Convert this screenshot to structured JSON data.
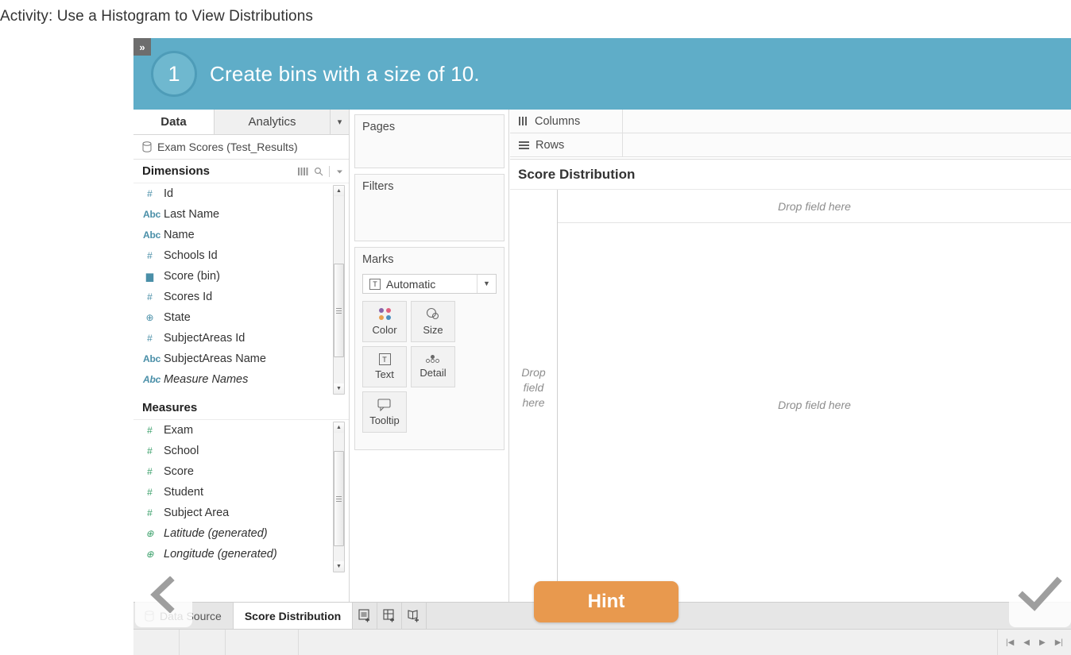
{
  "activity": {
    "title": "Activity: Use a Histogram to View Distributions"
  },
  "banner": {
    "collapse_label": "»",
    "step_number": "1",
    "instruction": "Create bins with a size of 10.",
    "background_color": "#5fadc8",
    "circle_color": "#6fb8cf"
  },
  "data_pane": {
    "tabs": [
      {
        "label": "Data",
        "active": true
      },
      {
        "label": "Analytics",
        "active": false
      }
    ],
    "tab_menu_icon": "vertical-ellipsis-icon",
    "datasource": {
      "icon": "database-icon",
      "label": "Exam Scores (Test_Results)"
    },
    "dimensions": {
      "title": "Dimensions",
      "icons": [
        "grid-icon",
        "search-icon",
        "chevron-down-icon"
      ],
      "fields": [
        {
          "icon": "number-icon",
          "glyph": "#",
          "label": "Id",
          "generated": false
        },
        {
          "icon": "text-abc-icon",
          "glyph": "Abc",
          "label": "Last Name",
          "generated": false
        },
        {
          "icon": "text-abc-icon",
          "glyph": "Abc",
          "label": "Name",
          "generated": false
        },
        {
          "icon": "number-icon",
          "glyph": "#",
          "label": "Schools Id",
          "generated": false
        },
        {
          "icon": "histogram-bin-icon",
          "glyph": "▆",
          "label": "Score (bin)",
          "generated": false
        },
        {
          "icon": "number-icon",
          "glyph": "#",
          "label": "Scores Id",
          "generated": false
        },
        {
          "icon": "geo-globe-icon",
          "glyph": "⊕",
          "label": "State",
          "generated": false
        },
        {
          "icon": "number-icon",
          "glyph": "#",
          "label": "SubjectAreas Id",
          "generated": false
        },
        {
          "icon": "text-abc-icon",
          "glyph": "Abc",
          "label": "SubjectAreas Name",
          "generated": false
        },
        {
          "icon": "text-abc-icon",
          "glyph": "Abc",
          "label": "Measure Names",
          "generated": true
        }
      ]
    },
    "measures": {
      "title": "Measures",
      "fields": [
        {
          "icon": "number-icon",
          "glyph": "#",
          "label": "Exam",
          "generated": false
        },
        {
          "icon": "number-icon",
          "glyph": "#",
          "label": "School",
          "generated": false
        },
        {
          "icon": "number-icon",
          "glyph": "#",
          "label": "Score",
          "generated": false
        },
        {
          "icon": "number-icon",
          "glyph": "#",
          "label": "Student",
          "generated": false
        },
        {
          "icon": "number-icon",
          "glyph": "#",
          "label": "Subject Area",
          "generated": false
        },
        {
          "icon": "geo-globe-icon",
          "glyph": "⊕",
          "label": "Latitude (generated)",
          "generated": true
        },
        {
          "icon": "geo-globe-icon",
          "glyph": "⊕",
          "label": "Longitude (generated)",
          "generated": true
        }
      ]
    }
  },
  "cards": {
    "pages": {
      "title": "Pages"
    },
    "filters": {
      "title": "Filters"
    },
    "marks": {
      "title": "Marks",
      "mark_type": "Automatic",
      "mark_type_icon": "text-box-icon",
      "buttons": [
        {
          "label": "Color",
          "icon": "color-dots-icon"
        },
        {
          "label": "Size",
          "icon": "size-circles-icon"
        },
        {
          "label": "Text",
          "icon": "text-box-icon"
        },
        {
          "label": "Detail",
          "icon": "detail-dots-icon"
        },
        {
          "label": "Tooltip",
          "icon": "tooltip-bubble-icon"
        }
      ]
    }
  },
  "shelves": [
    {
      "label": "Columns",
      "icon": "columns-icon",
      "value": ""
    },
    {
      "label": "Rows",
      "icon": "rows-icon",
      "value": ""
    }
  ],
  "viz": {
    "title": "Score Distribution",
    "column_drop_placeholder": "Drop field here",
    "row_drop_placeholder": "Drop\nfield\nhere",
    "center_drop_placeholder": "Drop field here"
  },
  "tabbar": {
    "datasource_tab": "Data Source",
    "sheet_tabs": [
      {
        "label": "Score Distribution",
        "active": true
      }
    ],
    "new_buttons": [
      {
        "icon": "new-worksheet-icon"
      },
      {
        "icon": "new-dashboard-icon"
      },
      {
        "icon": "new-story-icon"
      }
    ]
  },
  "statusbar": {
    "nav_icons": [
      "first-page-icon",
      "previous-page-icon",
      "next-page-icon",
      "last-page-icon"
    ]
  },
  "overlays": {
    "hint_button": {
      "label": "Hint",
      "color": "#e8994e"
    },
    "back_nav": {
      "icon": "chevron-left-icon"
    },
    "next_nav": {
      "icon": "checkmark-icon"
    }
  }
}
